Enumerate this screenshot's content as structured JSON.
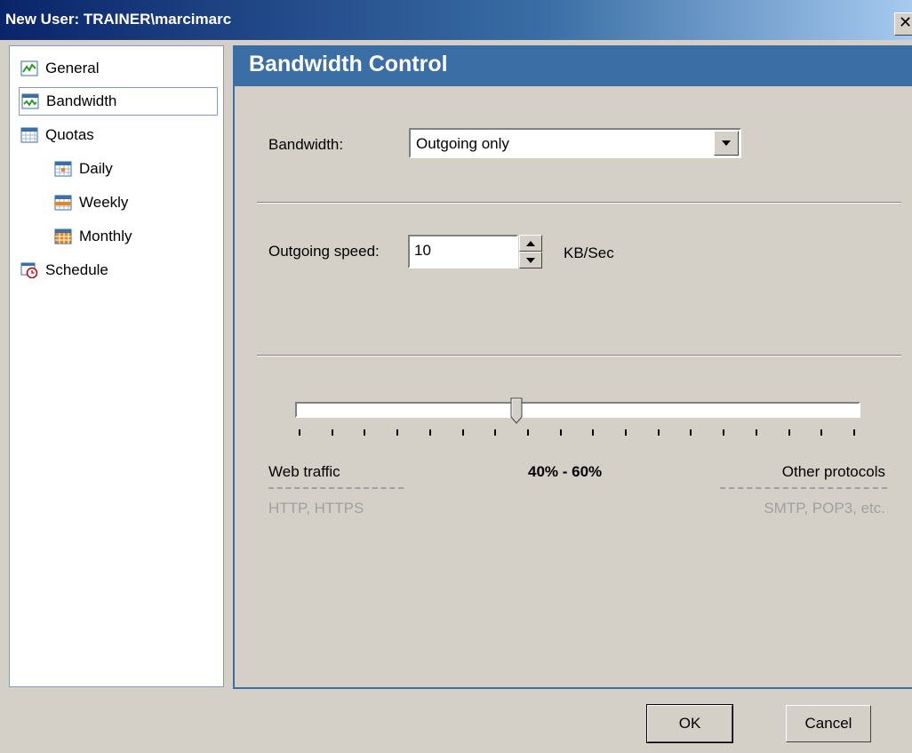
{
  "window": {
    "title": "New User: TRAINER\\marcimarc",
    "close_glyph": "✕"
  },
  "tree": {
    "items": [
      {
        "label": "General",
        "icon": "chart-icon",
        "selected": false
      },
      {
        "label": "Bandwidth",
        "icon": "bandwidth-icon",
        "selected": true
      },
      {
        "label": "Quotas",
        "icon": "calendar-icon",
        "selected": false
      },
      {
        "label": "Daily",
        "icon": "calendar-day-icon",
        "selected": false
      },
      {
        "label": "Weekly",
        "icon": "calendar-week-icon",
        "selected": false
      },
      {
        "label": "Monthly",
        "icon": "calendar-month-icon",
        "selected": false
      },
      {
        "label": "Schedule",
        "icon": "schedule-clock-icon",
        "selected": false
      }
    ]
  },
  "panel": {
    "title": "Bandwidth Control",
    "bandwidth_label": "Bandwidth:",
    "bandwidth_value": "Outgoing only",
    "outgoing_label": "Outgoing speed:",
    "outgoing_value": "10",
    "outgoing_unit": "KB/Sec",
    "slider": {
      "position_fraction": 0.4,
      "tick_count": 18,
      "ratio_text": "40% - 60%",
      "left_label": "Web traffic",
      "left_sub": "HTTP, HTTPS",
      "right_label": "Other protocols",
      "right_sub": "SMTP, POP3, etc."
    }
  },
  "buttons": {
    "ok": "OK",
    "cancel": "Cancel"
  },
  "colors": {
    "title_bar": "#0a246a",
    "header": "#3a6ea5",
    "face": "#d4d0c8"
  }
}
